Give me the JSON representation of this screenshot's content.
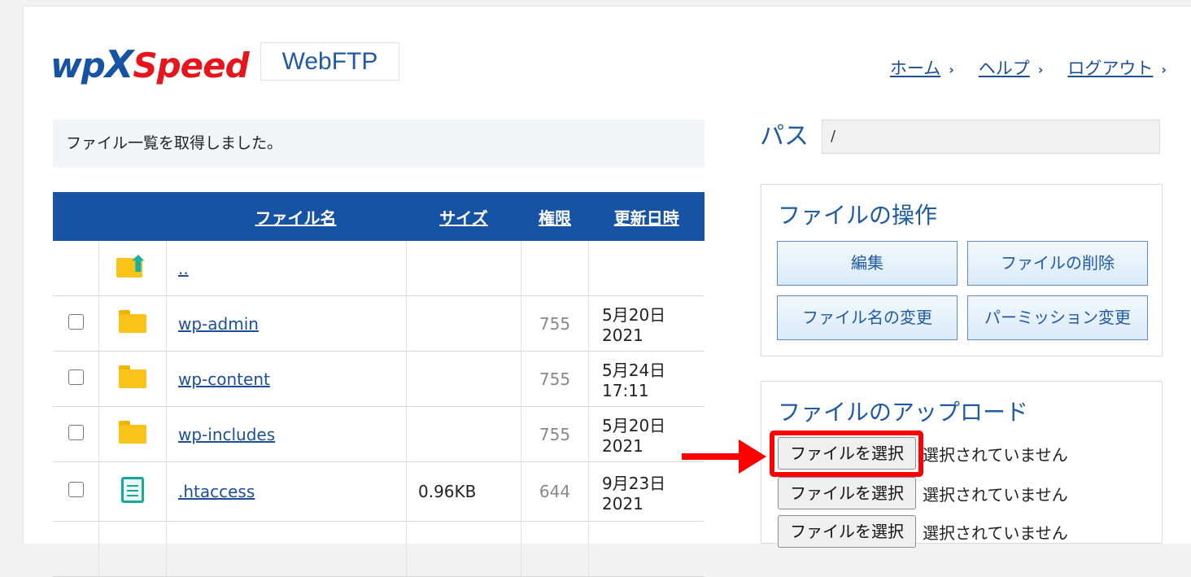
{
  "brand": {
    "logo_wp": "wp",
    "logo_x": "X",
    "logo_speed": "Speed",
    "app_name": "WebFTP",
    "wp_color": "#1753a4",
    "speed_color": "#e8141c"
  },
  "nav": {
    "home": "ホーム",
    "help": "ヘルプ",
    "logout": "ログアウト",
    "chevron": "›"
  },
  "message": "ファイル一覧を取得しました。",
  "table": {
    "headers": {
      "name": "ファイル名",
      "size": "サイズ",
      "perm": "権限",
      "date": "更新日時"
    },
    "rows": [
      {
        "name": "..",
        "size": "",
        "perm": "",
        "date": "",
        "icon": "parent-folder-icon"
      },
      {
        "name": "wp-admin",
        "size": "",
        "perm": "755",
        "date": "5月20日 2021",
        "icon": "folder-icon"
      },
      {
        "name": "wp-content",
        "size": "",
        "perm": "755",
        "date": "5月24日 17:11",
        "icon": "folder-icon"
      },
      {
        "name": "wp-includes",
        "size": "",
        "perm": "755",
        "date": "5月20日 2021",
        "icon": "folder-icon"
      },
      {
        "name": ".htaccess",
        "size": "0.96KB",
        "perm": "644",
        "date": "9月23日 2021",
        "icon": "file-icon"
      }
    ]
  },
  "path": {
    "label": "パス",
    "value": "/"
  },
  "operations": {
    "title": "ファイルの操作",
    "edit": "編集",
    "delete": "ファイルの削除",
    "rename": "ファイル名の変更",
    "permission": "パーミッション変更"
  },
  "upload": {
    "title": "ファイルのアップロード",
    "choose": "ファイルを選択",
    "no_file": "選択されていません"
  },
  "accent": {
    "header_blue": "#1753a4",
    "annotation_red": "#ff0000"
  }
}
